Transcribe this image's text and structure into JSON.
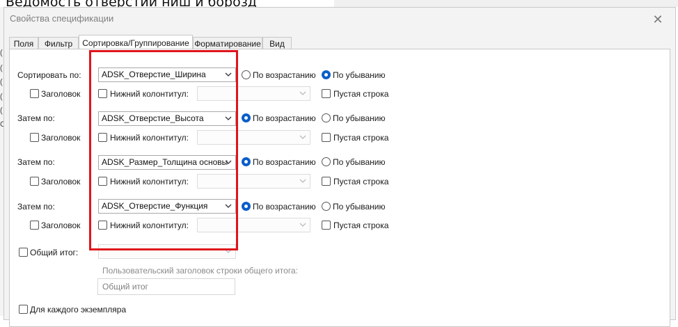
{
  "background": {
    "title": "Ведомость отверстий ниш и борозд",
    "fragments": [
      "(",
      "(",
      "(",
      "(",
      "(",
      "С"
    ]
  },
  "dialog": {
    "title": "Свойства спецификации",
    "close": "✕"
  },
  "tabs": [
    "Поля",
    "Фильтр",
    "Сортировка/Группирование",
    "Форматирование",
    "Вид"
  ],
  "active_tab": "Сортировка/Группирование",
  "sort_levels": [
    {
      "label": "Сортировать по:",
      "field": "ADSK_Отверстие_Ширина",
      "order": "По убыванию",
      "header": "Заголовок",
      "footer": "Нижний колонтитул:",
      "blank": "Пустая строка"
    },
    {
      "label": "Затем по:",
      "field": "ADSK_Отверстие_Высота",
      "order": "По возрастанию",
      "header": "Заголовок",
      "footer": "Нижний колонтитул:",
      "blank": "Пустая строка"
    },
    {
      "label": "Затем по:",
      "field": "ADSK_Размер_Толщина основы",
      "order": "По возрастанию",
      "header": "Заголовок",
      "footer": "Нижний колонтитул:",
      "blank": "Пустая строка"
    },
    {
      "label": "Затем по:",
      "field": "ADSK_Отверстие_Функция",
      "order": "По возрастанию",
      "header": "Заголовок",
      "footer": "Нижний колонтитул:",
      "blank": "Пустая строка"
    }
  ],
  "order_options": {
    "asc": "По возрастанию",
    "desc": "По убыванию"
  },
  "grand_total": {
    "label": "Общий итог:",
    "custom_header_label": "Пользовательский заголовок строки общего итога:",
    "custom_header_value": "Общий итог"
  },
  "each_instance": "Для каждого экземпляра",
  "colors": {
    "highlight": "#e0141b",
    "radio_selected": "#0a5ec8"
  },
  "icons": {
    "dropdown": "chevron-down-icon",
    "close": "close-icon"
  }
}
